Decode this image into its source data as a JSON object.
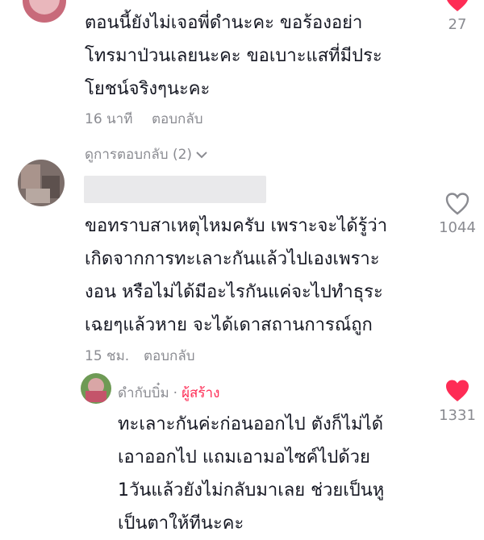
{
  "comment1": {
    "lines": [
      "ตอนนี้ยังไม่เจอพี่ดำนะคะ ขอร้องอย่า",
      "โทรมาป่วนเลยนะคะ ขอเบาะแสที่มีประ",
      "โยชน์จริงๆนะคะ"
    ],
    "time": "16 นาที",
    "reply_label": "ตอบกลับ",
    "likes": "27",
    "view_replies": "ดูการตอบกลับ (2)",
    "heart_color": "#fe2c55"
  },
  "comment2": {
    "lines": [
      "ขอทราบสาเหตุไหมครับ เพราะจะได้รู้ว่า",
      "เกิดจากการทะเลาะกันแล้วไปเองเพราะ",
      "งอน หรือไม่ได้มีอะไรกันแค่จะไปทำธุระ",
      "เฉยๆแล้วหาย จะได้เดาสถานการณ์ถูก"
    ],
    "time": "15 ชม.",
    "reply_label": "ตอบกลับ",
    "likes": "1044",
    "heart_color": "#8a8b91"
  },
  "reply": {
    "username": "ดำกับบิ๋ม",
    "separator": "·",
    "creator_badge": "ผู้สร้าง",
    "creator_color": "#fe2c55",
    "lines": [
      "ทะเลาะกันค่ะก่อนออกไป ตังก็ไม่ได้",
      "เอาออกไป แถมเอามอไซค์ไปด้วย",
      "1วันแล้วยังไม่กลับมาเลย ช่วยเป็นหู",
      "เป็นตาให้ทีนะคะ"
    ],
    "likes": "1331",
    "heart_color": "#fe2c55"
  }
}
